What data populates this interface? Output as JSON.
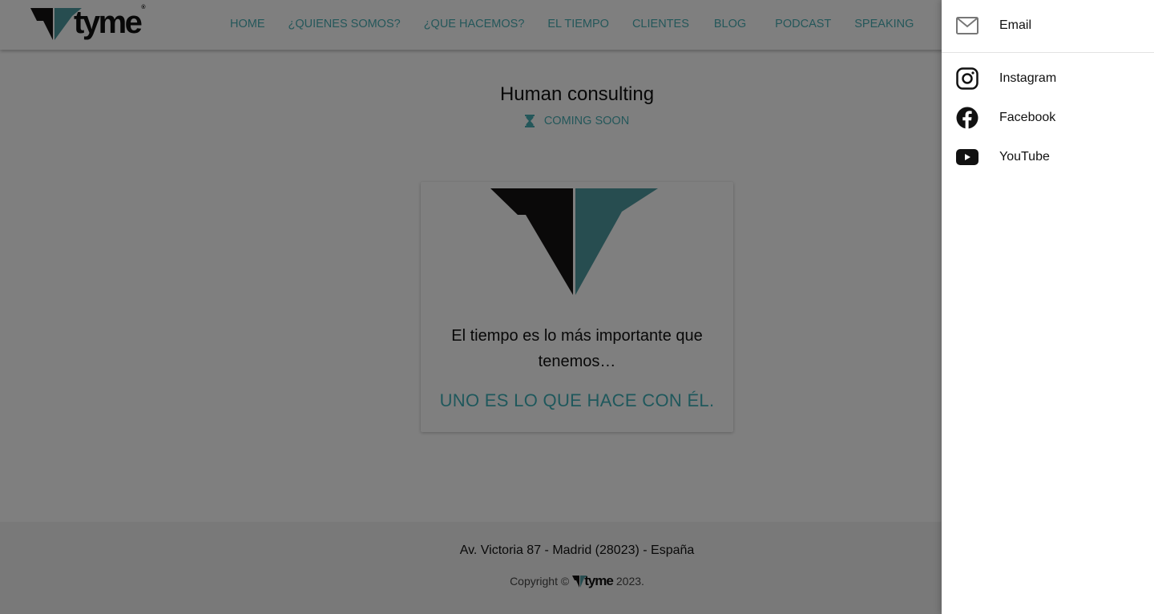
{
  "brand": {
    "name": "tyme",
    "registered": "®",
    "teal": "#4f9aa0",
    "dark": "#141213"
  },
  "nav": {
    "items": [
      {
        "label": "HOME"
      },
      {
        "label": "¿QUIENES SOMOS?"
      },
      {
        "label": "¿QUE HACEMOS?"
      },
      {
        "label": "EL TIEMPO"
      },
      {
        "label": "CLIENTES"
      },
      {
        "label": "BLOG"
      },
      {
        "label": "PODCAST"
      },
      {
        "label": "SPEAKING"
      }
    ]
  },
  "main": {
    "title": "Human consulting",
    "status": "COMING SOON",
    "card": {
      "quote": "El tiempo es lo más importante que tenemos…",
      "tagline": "UNO ES LO QUE HACE CON ÉL."
    }
  },
  "footer": {
    "address": "Av. Victoria 87 - Madrid (28023) - España",
    "copyright_prefix": "Copyright ©",
    "copyright_year": "2023."
  },
  "drawer": {
    "items": [
      {
        "label": "Email",
        "icon": "email-icon"
      },
      {
        "label": "Instagram",
        "icon": "instagram-icon"
      },
      {
        "label": "Facebook",
        "icon": "facebook-icon"
      },
      {
        "label": "YouTube",
        "icon": "youtube-icon"
      }
    ]
  },
  "colors": {
    "accent": "#48aeb4",
    "overlay": "rgba(0,0,0,0.5)"
  }
}
